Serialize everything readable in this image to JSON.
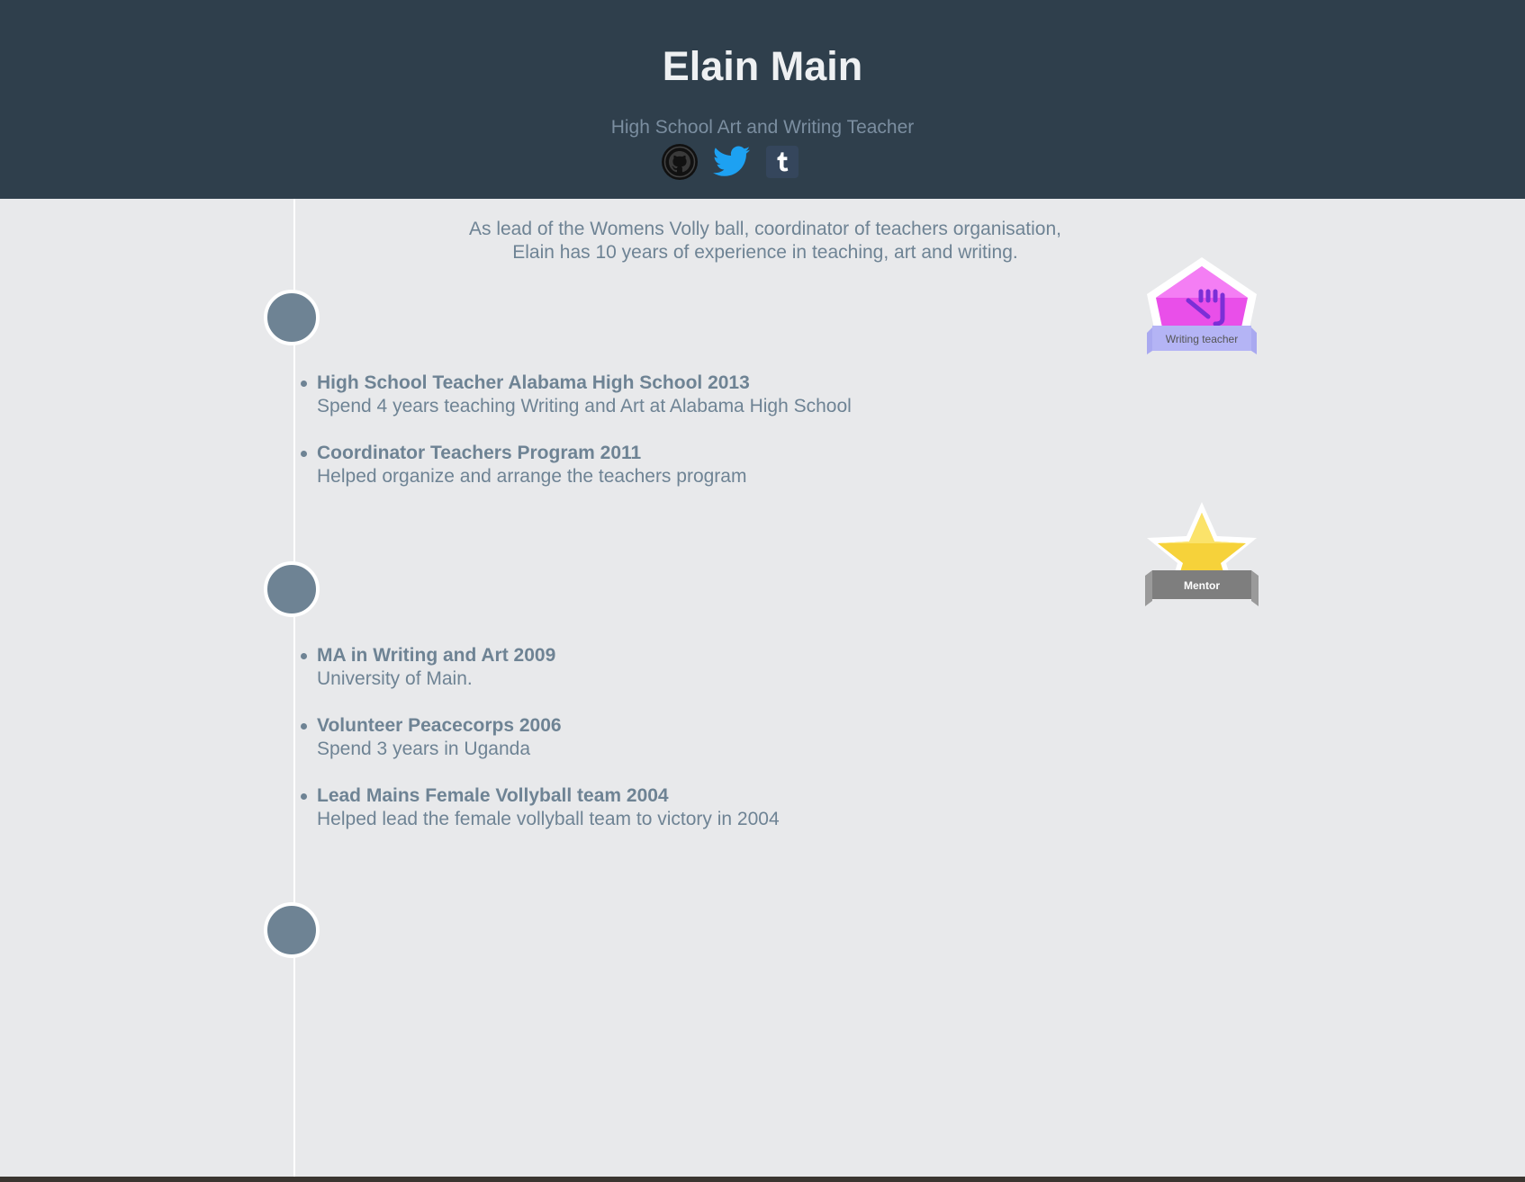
{
  "header": {
    "name": "Elain Main",
    "subtitle": "High School Art and Writing Teacher",
    "social": [
      {
        "icon": "github-icon",
        "label": "GitHub"
      },
      {
        "icon": "twitter-icon",
        "label": "Twitter"
      },
      {
        "icon": "tumblr-icon",
        "label": "Tumblr"
      }
    ]
  },
  "intro": {
    "line1": "As lead of the Womens Volly ball, coordinator of teachers organisation,",
    "line2": "Elain has 10 years of experience in teaching, art and writing."
  },
  "timeline": [
    {
      "events": [
        {
          "title": "High School Teacher Alabama High School 2013",
          "desc": "Spend 4 years teaching Writing and Art at Alabama High School"
        },
        {
          "title": "Coordinator Teachers Program 2011",
          "desc": "Helped organize and arrange the teachers program"
        }
      ]
    },
    {
      "events": [
        {
          "title": "MA in Writing and Art 2009",
          "desc": "University of Main."
        },
        {
          "title": "Volunteer Peacecorps 2006",
          "desc": "Spend 3 years in Uganda"
        },
        {
          "title": "Lead Mains Female Vollyball team 2004",
          "desc": "Helped lead the female vollyball team to victory in 2004"
        }
      ]
    }
  ],
  "badges": [
    {
      "label": "Writing teacher",
      "icon": "pen-and-brush-icon",
      "color": "#e94fe9"
    },
    {
      "label": "Mentor",
      "icon": "star-icon",
      "color": "#f5c518"
    }
  ],
  "colors": {
    "header_bg": "#2f3f4c",
    "page_bg": "#e8e9eb",
    "text": "#6e8394",
    "twitter": "#1da1f2",
    "tumblr": "#35465c"
  }
}
